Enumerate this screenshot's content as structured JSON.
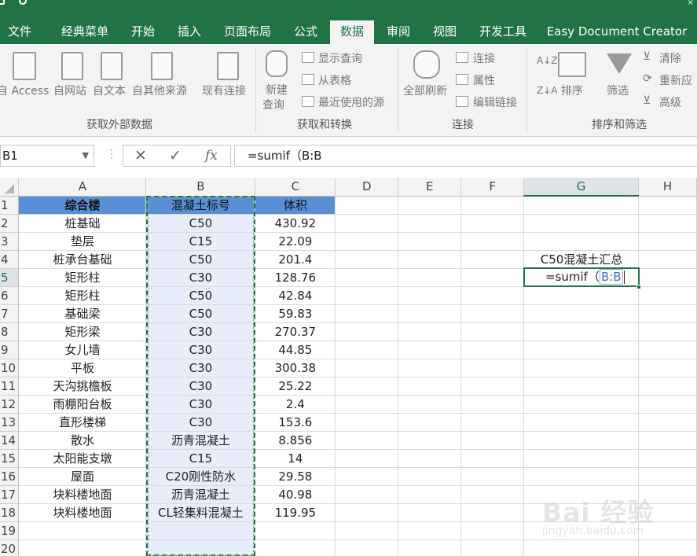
{
  "tabs": [
    "文件",
    "经典菜单",
    "开始",
    "插入",
    "页面布局",
    "公式",
    "数据",
    "审阅",
    "视图",
    "开发工具",
    "Easy Document Creator"
  ],
  "active_tab": "数据",
  "ribbon": {
    "groups": {
      "external": {
        "label": "获取外部数据",
        "items": [
          "自 Access",
          "自网站",
          "自文本",
          "自其他来源",
          "现有连接"
        ]
      },
      "transform": {
        "label": "获取和转换",
        "new_query": [
          "新建",
          "查询"
        ],
        "items": [
          "显示查询",
          "从表格",
          "最近使用的源"
        ]
      },
      "connections": {
        "label": "连接",
        "refresh_all": "全部刷新",
        "items": [
          "连接",
          "属性",
          "编辑链接"
        ]
      },
      "sort_filter": {
        "label": "排序和筛选",
        "sort": "排序",
        "filter": "筛选",
        "items": [
          "清除",
          "重新应",
          "高级"
        ]
      }
    }
  },
  "formula_bar": {
    "name_box": "B1",
    "cancel_icon": "✕",
    "enter_icon": "✓",
    "fx_icon": "fx",
    "formula": "=sumif（B:B"
  },
  "columns": [
    "A",
    "B",
    "C",
    "D",
    "E",
    "F",
    "G",
    "H"
  ],
  "selected_column": "G",
  "selected_row": 5,
  "headers": {
    "A": "综合楼",
    "B": "混凝土标号",
    "C": "体积"
  },
  "rows": [
    {
      "n": 2,
      "a": "桩基础",
      "b": "C50",
      "c": "430.92"
    },
    {
      "n": 3,
      "a": "垫层",
      "b": "C15",
      "c": "22.09"
    },
    {
      "n": 4,
      "a": "桩承台基础",
      "b": "C50",
      "c": "201.4"
    },
    {
      "n": 5,
      "a": "矩形柱",
      "b": "C30",
      "c": "128.76"
    },
    {
      "n": 6,
      "a": "矩形柱",
      "b": "C50",
      "c": "42.84"
    },
    {
      "n": 7,
      "a": "基础梁",
      "b": "C50",
      "c": "59.83"
    },
    {
      "n": 8,
      "a": "矩形梁",
      "b": "C30",
      "c": "270.37"
    },
    {
      "n": 9,
      "a": "女儿墙",
      "b": "C30",
      "c": "44.85"
    },
    {
      "n": 10,
      "a": "平板",
      "b": "C30",
      "c": "300.38"
    },
    {
      "n": 11,
      "a": "天沟挑檐板",
      "b": "C30",
      "c": "25.22"
    },
    {
      "n": 12,
      "a": "雨棚阳台板",
      "b": "C30",
      "c": "2.4"
    },
    {
      "n": 13,
      "a": "直形楼梯",
      "b": "C30",
      "c": "153.6"
    },
    {
      "n": 14,
      "a": "散水",
      "b": "沥青混凝土",
      "c": "8.856"
    },
    {
      "n": 15,
      "a": "太阳能支墩",
      "b": "C15",
      "c": "14"
    },
    {
      "n": 16,
      "a": "屋面",
      "b": "C20刚性防水",
      "c": "29.58"
    },
    {
      "n": 17,
      "a": "块料楼地面",
      "b": "沥青混凝土",
      "c": "40.98"
    },
    {
      "n": 18,
      "a": "块料楼地面",
      "b": "CL轻集料混凝土",
      "c": "119.95"
    },
    {
      "n": 19,
      "a": "",
      "b": "",
      "c": ""
    },
    {
      "n": 20,
      "a": "",
      "b": "",
      "c": ""
    }
  ],
  "g4_label": "C50混凝土汇总",
  "g5_edit": {
    "prefix": "=sumif（",
    "ref": "B:B"
  },
  "watermark": {
    "brand": "Bai 经验",
    "url": "jingyan.baidu.com"
  },
  "colors": {
    "excel_green": "#217346",
    "header_fill": "#5b8fd5",
    "selection_fill": "#e8eef9"
  }
}
